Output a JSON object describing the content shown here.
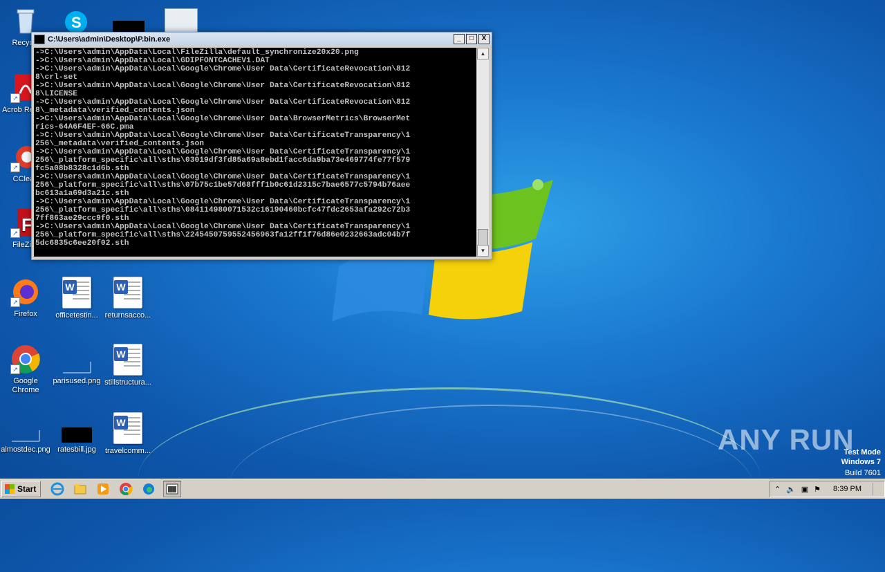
{
  "desktop": {
    "icons": [
      {
        "label": "Recycle",
        "icon": "recycle-bin-icon"
      },
      {
        "label": "Acrob Reader",
        "icon": "acrobat-reader-icon"
      },
      {
        "label": "CClean",
        "icon": "ccleaner-icon"
      },
      {
        "label": "FileZilla",
        "icon": "filezilla-icon"
      },
      {
        "label": "Firefox",
        "icon": "firefox-icon"
      },
      {
        "label": "officetestin...",
        "icon": "word-document-icon"
      },
      {
        "label": "returnsacco...",
        "icon": "word-document-icon"
      },
      {
        "label": "Google Chrome",
        "icon": "chrome-icon"
      },
      {
        "label": "parisused.png",
        "icon": "image-file-icon"
      },
      {
        "label": "stillstructura...",
        "icon": "word-document-icon"
      },
      {
        "label": "almostdec.png",
        "icon": "image-file-icon"
      },
      {
        "label": "ratesbill.jpg",
        "icon": "image-file-icon"
      },
      {
        "label": "travelcomm...",
        "icon": "word-document-icon"
      }
    ]
  },
  "console_window": {
    "title": "C:\\Users\\admin\\Desktop\\P.bin.exe",
    "minimize": "_",
    "maximize": "□",
    "close": "X",
    "lines": [
      "->C:\\Users\\admin\\AppData\\Local\\FileZilla\\default_synchronize20x20.png",
      "->C:\\Users\\admin\\AppData\\Local\\GDIPFONTCACHEV1.DAT",
      "->C:\\Users\\admin\\AppData\\Local\\Google\\Chrome\\User Data\\CertificateRevocation\\812",
      "8\\crl-set",
      "->C:\\Users\\admin\\AppData\\Local\\Google\\Chrome\\User Data\\CertificateRevocation\\812",
      "8\\LICENSE",
      "->C:\\Users\\admin\\AppData\\Local\\Google\\Chrome\\User Data\\CertificateRevocation\\812",
      "8\\_metadata\\verified_contents.json",
      "->C:\\Users\\admin\\AppData\\Local\\Google\\Chrome\\User Data\\BrowserMetrics\\BrowserMet",
      "rics-64A6F4EF-66C.pma",
      "->C:\\Users\\admin\\AppData\\Local\\Google\\Chrome\\User Data\\CertificateTransparency\\1",
      "256\\_metadata\\verified_contents.json",
      "->C:\\Users\\admin\\AppData\\Local\\Google\\Chrome\\User Data\\CertificateTransparency\\1",
      "256\\_platform_specific\\all\\sths\\03019df3fd85a69a8ebd1facc6da9ba73e469774fe77f579",
      "fc5a08b8328c1d6b.sth",
      "->C:\\Users\\admin\\AppData\\Local\\Google\\Chrome\\User Data\\CertificateTransparency\\1",
      "256\\_platform_specific\\all\\sths\\07b75c1be57d68fff1b0c61d2315c7bae6577c5794b76aee",
      "bc613a1a69d3a21c.sth",
      "->C:\\Users\\admin\\AppData\\Local\\Google\\Chrome\\User Data\\CertificateTransparency\\1",
      "256\\_platform_specific\\all\\sths\\084114980071532c16190460bcfc47fdc2653afa292c72b3",
      "7ff863ae29ccc9f0.sth",
      "->C:\\Users\\admin\\AppData\\Local\\Google\\Chrome\\User Data\\CertificateTransparency\\1",
      "256\\_platform_specific\\all\\sths\\2245450759552456963fa12ff1f76d86e0232663adc04b7f",
      "5dc6835c6ee20f02.sth"
    ]
  },
  "watermark": {
    "brand": "ANY RUN",
    "line1": "Test Mode",
    "line2": "Windows 7",
    "line3": "Build 7601"
  },
  "taskbar": {
    "start_label": "Start",
    "clock": "8:39 PM",
    "pinned": [
      "internet-explorer-icon",
      "explorer-folder-icon",
      "media-player-icon",
      "chrome-icon",
      "edge-icon",
      "console-window-icon"
    ]
  },
  "colors": {
    "console_bg": "#000000",
    "console_text": "#c0c0c0",
    "taskbar": "#d4d0c8"
  }
}
